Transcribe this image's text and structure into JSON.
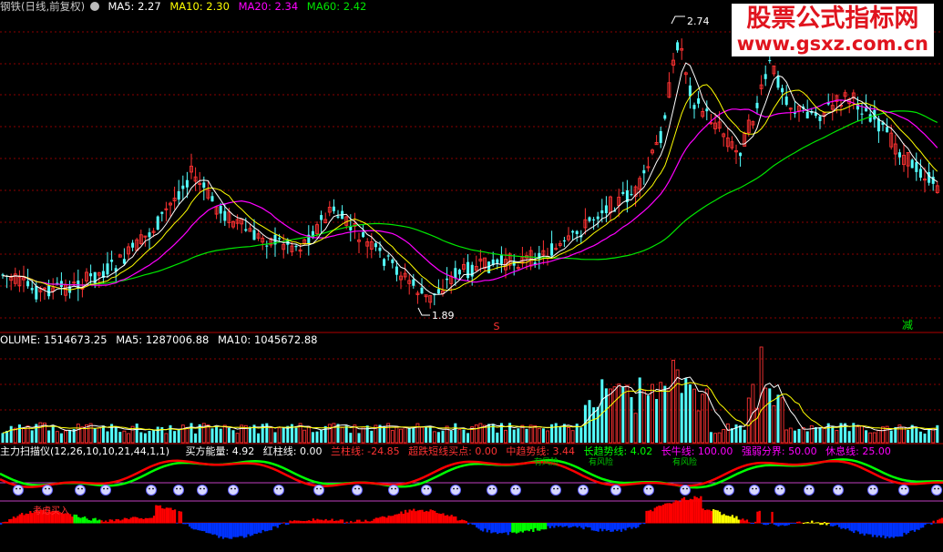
{
  "price_header": {
    "title": "钢铁(日线,前复权)",
    "ma5": "MA5: 2.27",
    "ma10": "MA10: 2.30",
    "ma20": "MA20: 2.34",
    "ma60": "MA60: 2.42"
  },
  "price_annotations": {
    "high": "2.74",
    "low": "1.89",
    "s_marker": "S",
    "jian_marker": "减"
  },
  "brand": {
    "line1": "股票公式指标网",
    "line2": "www.gsxz.com.cn"
  },
  "volume_header": {
    "volume": "OLUME: 1514673.25",
    "ma5": "MA5: 1287006.88",
    "ma10": "MA10: 1045672.88"
  },
  "indicator_header": {
    "name": "主力扫描仪(12,26,10,10,21,44,1,1)",
    "buy_energy": "买方能量: 4.92",
    "red_bar": "红柱线: 0.00",
    "blue_bar": "兰柱线: -24.85",
    "oversold": "超跌短线买点: 0.00",
    "mid_trend": "中趋势线: 3.44",
    "long_trend": "长趋势线: 4.02",
    "long_bull": "长牛线: 100.00",
    "strong_weak": "强弱分界: 50.00",
    "rest": "休息线: 25.00"
  },
  "indicator_annotations": {
    "buy_label": "考虑买入",
    "risk_labels": [
      "有风险",
      "有风险",
      "有风险"
    ]
  },
  "colors": {
    "up": "#ff3232",
    "down": "#54ffff",
    "ma5": "#ffffff",
    "ma10": "#ffff00",
    "ma20": "#ff00ff",
    "ma60": "#00e600",
    "grid": "#8b0000",
    "ind_red": "#ff0000",
    "ind_blue": "#0033ff",
    "ind_green": "#00ff00",
    "ind_yellow": "#ffff00"
  }
}
